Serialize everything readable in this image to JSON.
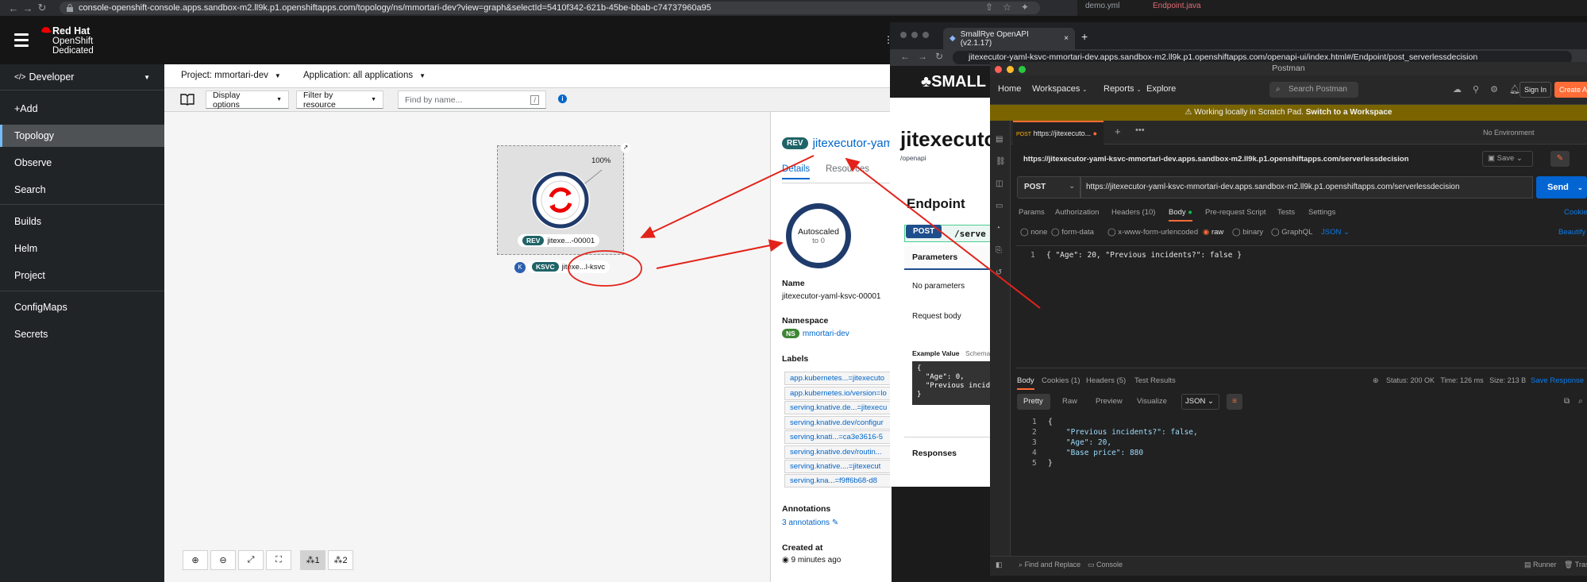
{
  "browser1": {
    "url": "console-openshift-console.apps.sandbox-m2.ll9k.p1.openshiftapps.com/topology/ns/mmortari-dev?view=graph&selectId=5410f342-621b-45be-bbab-c74737960a95",
    "right_tabs": [
      "demo.yml",
      "Endpoint.java"
    ]
  },
  "openshift": {
    "logo": {
      "line1": "Red Hat",
      "line2": "OpenShift",
      "line3": "Dedicated"
    },
    "perspective": "Developer",
    "nav": [
      "+Add",
      "Topology",
      "Observe",
      "Search",
      "Builds",
      "Helm",
      "Project",
      "ConfigMaps",
      "Secrets"
    ],
    "active_nav": "Topology",
    "project": "Project: mmortari-dev",
    "application": "Application: all applications",
    "toolbar": {
      "display_options": "Display options",
      "filter": "Filter by resource",
      "find_placeholder": "Find by name...",
      "slash": "/"
    },
    "node": {
      "percent": "100%",
      "rev_badge": "REV",
      "rev_label": "jitexe...-00001",
      "ksvc_badge": "KSVC",
      "ksvc_label": "jitexe...l-ksvc",
      "k_badge": "K"
    },
    "zoom": {
      "layout1": "1",
      "layout2": "2"
    }
  },
  "detail": {
    "rev_badge": "REV",
    "title": "jitexecutor-yaml",
    "tabs": [
      "Details",
      "Resources"
    ],
    "donut_line1": "Autoscaled",
    "donut_line2": "to 0",
    "name_label": "Name",
    "name_value": "jitexecutor-yaml-ksvc-00001",
    "ns_label": "Namespace",
    "ns_badge": "NS",
    "ns_value": "mmortari-dev",
    "labels_label": "Labels",
    "labels": [
      "app.kubernetes...=jitexecuto",
      "app.kubernetes.io/version=lo",
      "serving.knative.de...=jitexecu",
      "serving.knative.dev/configur",
      "serving.knati...=ca3e3616-5",
      "serving.knative.dev/routin...",
      "serving.knative....=jitexecut",
      "serving.kna...=f9ff6b68-d8"
    ],
    "annotations_label": "Annotations",
    "annotations_value": "3 annotations",
    "created_label": "Created at",
    "created_value": "9 minutes ago"
  },
  "browser2": {
    "tab_title": "SmallRye OpenAPI (v2.1.17)",
    "url": "jitexecutor-yaml-ksvc-mmortari-dev.apps.sandbox-m2.ll9k.p1.openshiftapps.com/openapi-ui/index.html#/Endpoint/post_serverlessdecision",
    "logo": "SMALL",
    "heading": "jitexecuto",
    "sub": "/openapi",
    "endpoint": "Endpoint",
    "method": "POST",
    "path": "/serve",
    "parameters": "Parameters",
    "no_params": "No parameters",
    "request_body": "Request body",
    "example_value": "Example Value",
    "schema": "Schema",
    "example_lines": [
      "{",
      "  \"Age\": 0,",
      "  \"Previous incide",
      "}"
    ],
    "responses": "Responses"
  },
  "postman": {
    "title": "Postman",
    "nav": [
      "Home",
      "Workspaces",
      "Reports",
      "Explore"
    ],
    "search": "Search Postman",
    "sign_in": "Sign In",
    "create": "Create A",
    "banner_text": "Working locally in Scratch Pad.",
    "banner_link": "Switch to a Workspace",
    "tab": "https://jitexecuto...",
    "env": "No Environment",
    "request_title": "https://jitexecutor-yaml-ksvc-mmortari-dev.apps.sandbox-m2.ll9k.p1.openshiftapps.com/serverlessdecision",
    "save": "Save",
    "method": "POST",
    "request_url": "https://jitexecutor-yaml-ksvc-mmortari-dev.apps.sandbox-m2.ll9k.p1.openshiftapps.com/serverlessdecision",
    "send": "Send",
    "req_tabs": [
      "Params",
      "Authorization",
      "Headers (10)",
      "Body",
      "Pre-request Script",
      "Tests",
      "Settings"
    ],
    "cookies": "Cookie",
    "body_types": [
      "none",
      "form-data",
      "x-www-form-urlencoded",
      "raw",
      "binary",
      "GraphQL"
    ],
    "json": "JSON",
    "beautify": "Beautify",
    "request_body": "{ \"Age\": 20, \"Previous incidents?\": false }",
    "resp_tabs": [
      "Body",
      "Cookies (1)",
      "Headers (5)",
      "Test Results"
    ],
    "status": "Status: 200 OK",
    "time": "Time: 126 ms",
    "size": "Size: 213 B",
    "save_response": "Save Response",
    "view_tabs": [
      "Pretty",
      "Raw",
      "Preview",
      "Visualize"
    ],
    "resp_lines": [
      "{",
      "    \"Previous incidents?\": false,",
      "    \"Age\": 20,",
      "    \"Base price\": 880",
      "}"
    ],
    "footer": [
      "Find and Replace",
      "Console",
      "Runner",
      "Trash"
    ]
  }
}
